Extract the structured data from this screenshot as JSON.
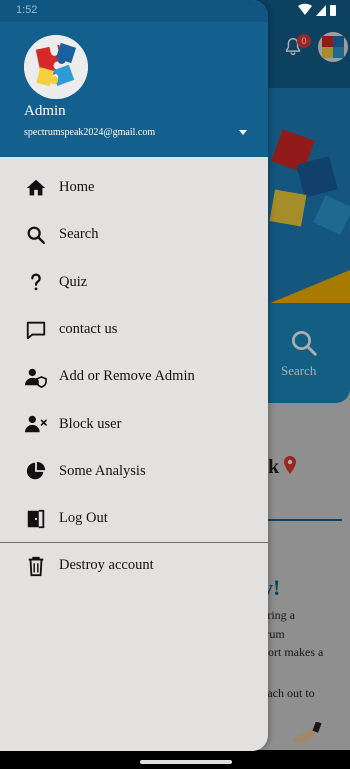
{
  "status_bar": {
    "time": "1:52"
  },
  "background": {
    "notification_count": "0",
    "search_label": "Search",
    "heading_fragment": "k",
    "card_title_fragment": "y!",
    "text_lines": [
      "ering a",
      "trum",
      "port makes a",
      "each out to"
    ]
  },
  "drawer": {
    "user_name": "Admin",
    "user_email": "spectrumspeak2024@gmail.com",
    "menu": [
      {
        "label": "Home",
        "icon": "home-icon"
      },
      {
        "label": "Search",
        "icon": "search-icon"
      },
      {
        "label": "Quiz",
        "icon": "question-icon"
      },
      {
        "label": "contact us",
        "icon": "chat-bubble-icon"
      },
      {
        "label": "Add or Remove Admin",
        "icon": "admin-shield-icon"
      },
      {
        "label": "Block user",
        "icon": "block-user-icon"
      },
      {
        "label": "Some Analysis",
        "icon": "pie-chart-icon"
      },
      {
        "label": "Log Out",
        "icon": "logout-door-icon"
      }
    ],
    "destroy": {
      "label": "Destroy account",
      "icon": "trash-icon"
    }
  },
  "colors": {
    "header_blue": "#13608e",
    "drawer_bg": "#e3e0e0",
    "accent_red": "#e53935"
  }
}
